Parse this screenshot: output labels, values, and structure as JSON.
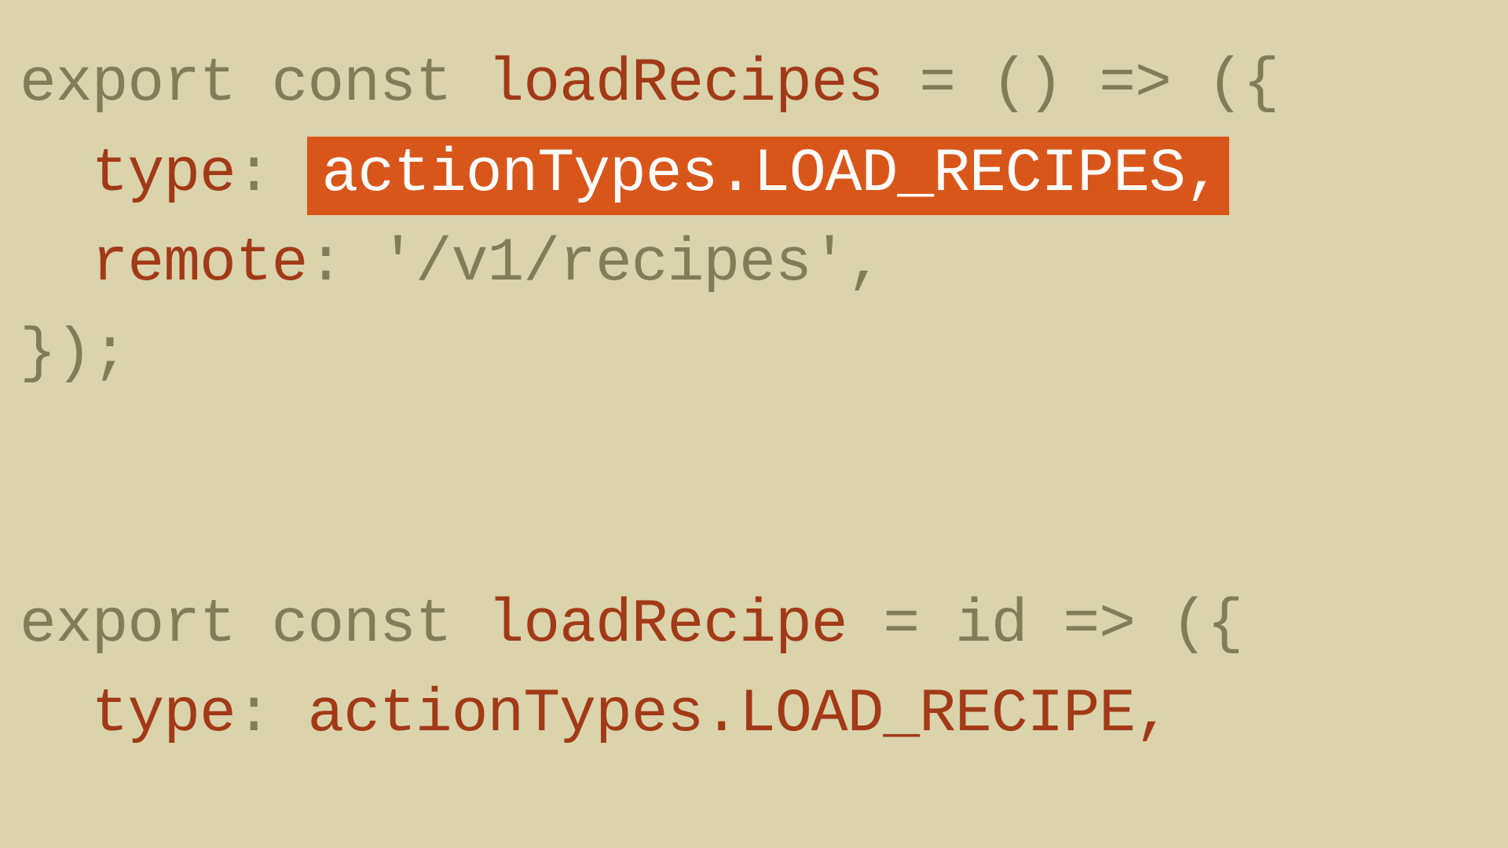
{
  "code": {
    "line1": {
      "export_const": "export const",
      "fn_name": "loadRecipes",
      "arrow_part": " = () => ({"
    },
    "line2": {
      "indent": "  ",
      "type_key": "type",
      "colon": ":",
      "highlighted": "actionTypes.LOAD_RECIPES,"
    },
    "line3": {
      "indent": "  ",
      "remote_key": "remote",
      "colon_space": ":",
      "path": " '/v1/recipes'",
      "comma": ","
    },
    "line4": {
      "closing": "});"
    },
    "line6": {
      "export_const": "export const",
      "fn_name": "loadRecipe",
      "arrow_part": " = id => ({"
    },
    "line7": {
      "indent": "  ",
      "type_key": "type",
      "colon": ":",
      "value": " actionTypes.LOAD_RECIPE,"
    }
  }
}
